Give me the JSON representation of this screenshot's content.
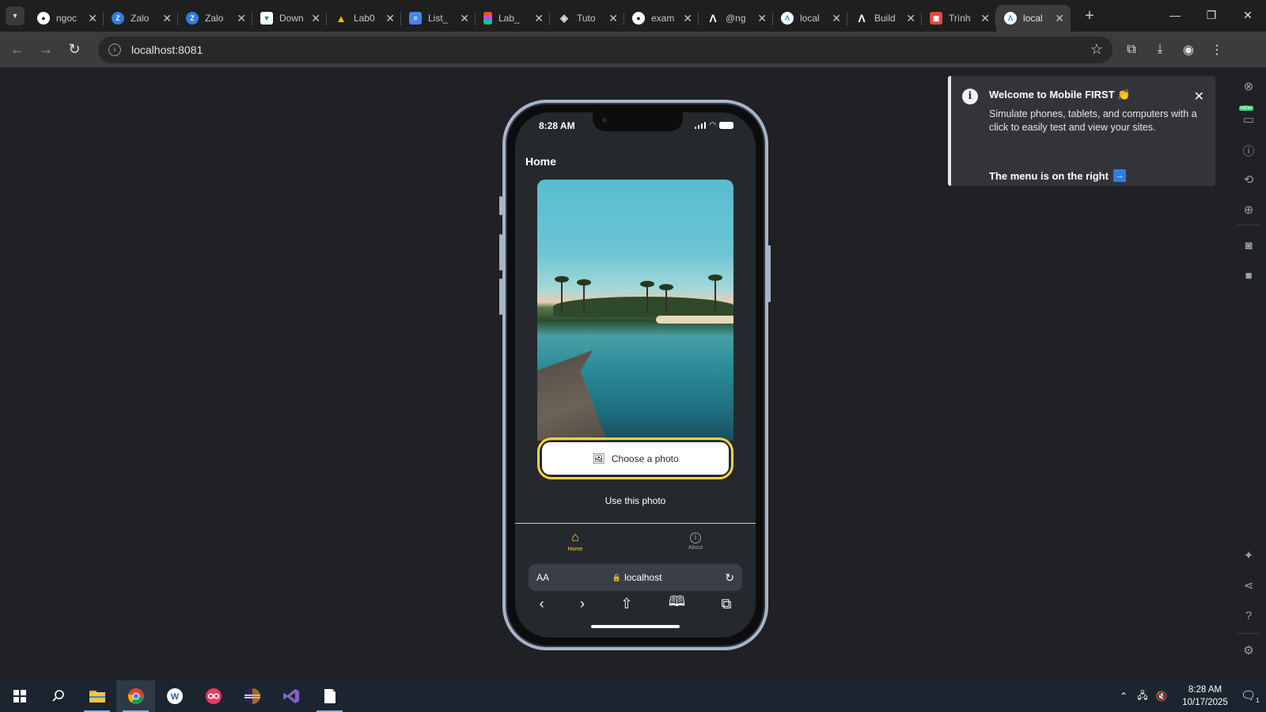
{
  "browser": {
    "tabs": [
      {
        "title": "ngoc",
        "icon": "github-icon",
        "color": "#ffffff"
      },
      {
        "title": "Zalo",
        "icon": "zalo-icon",
        "color": "#2f7de1"
      },
      {
        "title": "Zalo",
        "icon": "zalo-icon",
        "color": "#2f7de1"
      },
      {
        "title": "Down",
        "icon": "download-icon",
        "color": "#34a853"
      },
      {
        "title": "Lab0",
        "icon": "google-drive-icon",
        "color": "#fbbc04"
      },
      {
        "title": "List_",
        "icon": "google-docs-icon",
        "color": "#4285f4"
      },
      {
        "title": "Lab_",
        "icon": "figma-icon",
        "color": "#f24e1e"
      },
      {
        "title": "Tuto",
        "icon": "codepen-icon",
        "color": "#cccccc"
      },
      {
        "title": "exam",
        "icon": "github-icon",
        "color": "#ffffff"
      },
      {
        "title": "@ng",
        "icon": "angular-icon",
        "color": "#ffffff"
      },
      {
        "title": "local",
        "icon": "app-icon",
        "color": "#2f7de1"
      },
      {
        "title": "Build",
        "icon": "angular-icon",
        "color": "#ffffff"
      },
      {
        "title": "Trình",
        "icon": "image-icon",
        "color": "#e04a3b"
      },
      {
        "title": "local",
        "icon": "app-icon",
        "color": "#2f7de1",
        "active": true
      }
    ],
    "close_glyph": "✕",
    "new_tab_glyph": "+",
    "url": "localhost:8081"
  },
  "phone": {
    "time": "8:28 AM",
    "header_title": "Home",
    "choose_button": "Choose a photo",
    "use_photo": "Use this photo",
    "tabs": [
      {
        "label": "Home",
        "active": true
      },
      {
        "label": "About",
        "active": false
      }
    ],
    "safari": {
      "aa": "AA",
      "url": "localhost"
    }
  },
  "toast": {
    "title": "Welcome to Mobile FIRST 👏",
    "body": "Simulate phones, tablets, and computers with a click to easily test and view your sites.",
    "menu_hint": "The menu is on the right",
    "arrow": "→"
  },
  "sidebar": {
    "new_badge": "NEW"
  },
  "taskbar": {
    "time": "8:28 AM",
    "date": "10/17/2025",
    "notification_count": "1"
  },
  "colors": {
    "accent": "#ffd33d",
    "phone_bg": "#25292e",
    "frame": "#a8b4c8"
  }
}
